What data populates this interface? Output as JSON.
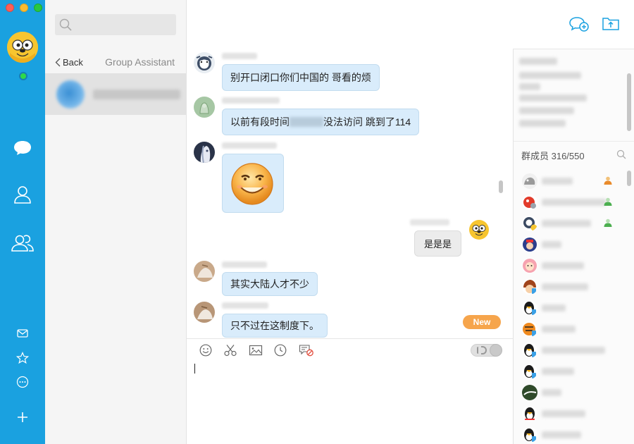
{
  "window": {
    "controls": [
      "close",
      "minimize",
      "zoom"
    ]
  },
  "rail": {
    "status": "online",
    "icons": [
      "chat-icon",
      "contacts-icon",
      "groups-icon",
      "mail-icon",
      "favorites-icon",
      "more-icon",
      "add-icon"
    ]
  },
  "session_list": {
    "search": {
      "placeholder": "",
      "value": ""
    },
    "back_label": "Back",
    "title": "Group Assistant"
  },
  "chat": {
    "header_actions": [
      "new-chat-icon",
      "upload-icon"
    ],
    "messages": [
      {
        "side": "left",
        "text_before": "别开口闭口你们中国的  哥看的烦"
      },
      {
        "side": "left",
        "text_before": "以前有段时间",
        "text_after": "没法访问 跳到了114"
      },
      {
        "side": "left",
        "type": "sticker"
      },
      {
        "side": "right",
        "text": "是是是"
      },
      {
        "side": "left",
        "text": "其实大陆人才不少"
      },
      {
        "side": "left",
        "text": "只不过在这制度下。"
      }
    ],
    "new_badge": "New",
    "toolbar": [
      "emoji-icon",
      "screenshot-icon",
      "image-icon",
      "history-icon",
      "block-icon"
    ],
    "composer": {
      "placeholder": "",
      "value": ""
    }
  },
  "info_panel": {
    "members_label": "群成员 316/550"
  },
  "colors": {
    "rail": "#1aa1e0",
    "bubble_incoming": "#d9ecfb",
    "bubble_outgoing": "#ececec",
    "new_badge": "#f6a54c",
    "online": "#2ed94a"
  }
}
